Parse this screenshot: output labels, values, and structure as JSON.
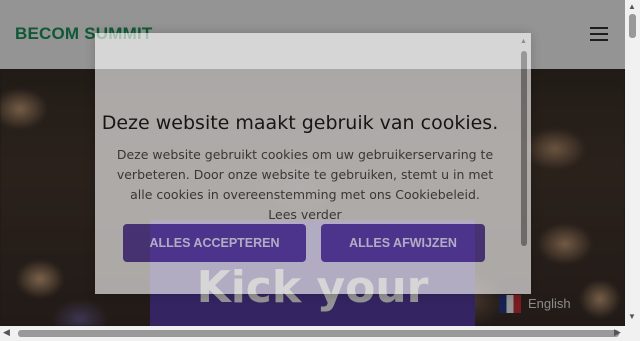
{
  "header": {
    "logo": "BECOM SUMMIT",
    "menu_icon": "hamburger-menu-icon"
  },
  "hero": {
    "title": "Kick your",
    "language_label": "English",
    "language_flag": "flag-icon"
  },
  "cookie_modal": {
    "title": "Deze website maakt gebruik van cookies.",
    "body": "Deze website gebruikt cookies om uw gebruikerservaring te verbeteren. Door onze website te gebruiken, stemt u in met alle cookies in overeenstemming met ons Cookiebeleid. Lees verder",
    "accept_label": "ALLES ACCEPTEREN",
    "reject_label": "ALLES AFWIJZEN"
  },
  "colors": {
    "brand_green": "#1a9a5e",
    "button_purple": "#5b3fa8"
  }
}
